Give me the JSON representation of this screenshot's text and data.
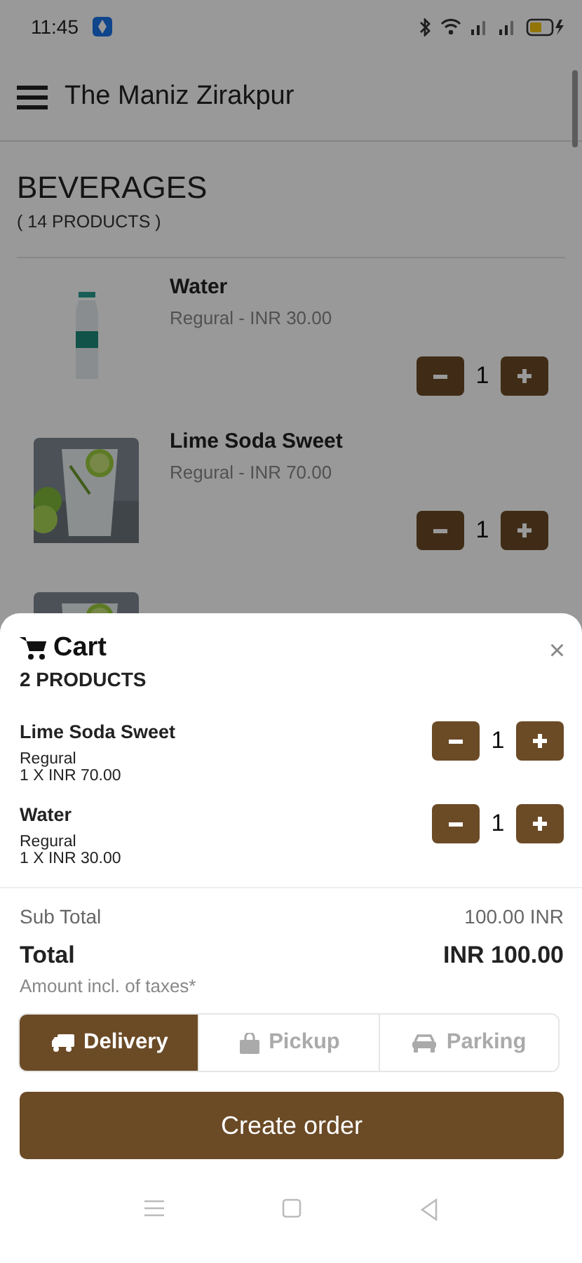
{
  "status_bar": {
    "time": "11:45"
  },
  "header": {
    "title": "The Maniz Zirakpur"
  },
  "category": {
    "title": "BEVERAGES",
    "count": "( 14 PRODUCTS )"
  },
  "products": [
    {
      "kind": "bottle",
      "name": "Water",
      "detail": "Regural - INR 30.00",
      "quantity": "1"
    },
    {
      "kind": "glass",
      "name": "Lime Soda Sweet",
      "detail": "Regural - INR 70.00",
      "quantity": "1"
    },
    {
      "kind": "glass"
    }
  ],
  "cart": {
    "title": "Cart",
    "count": "2 PRODUCTS",
    "close": "×",
    "items": [
      {
        "name": "Lime Soda Sweet",
        "variant": "Regural",
        "line": "1 X INR 70.00",
        "quantity": "1"
      },
      {
        "name": "Water",
        "variant": "Regural",
        "line": "1 X INR 30.00",
        "quantity": "1"
      }
    ],
    "sub_total": {
      "label": "Sub Total",
      "value": "100.00 INR"
    },
    "total": {
      "label": "Total",
      "value": "INR 100.00",
      "note": "Amount incl. of taxes*"
    },
    "modes": [
      {
        "kind": "truck",
        "label": "Delivery",
        "selected": true
      },
      {
        "kind": "bag",
        "label": "Pickup",
        "selected": false
      },
      {
        "kind": "car",
        "label": "Parking",
        "selected": false
      }
    ],
    "action": "Create order"
  }
}
